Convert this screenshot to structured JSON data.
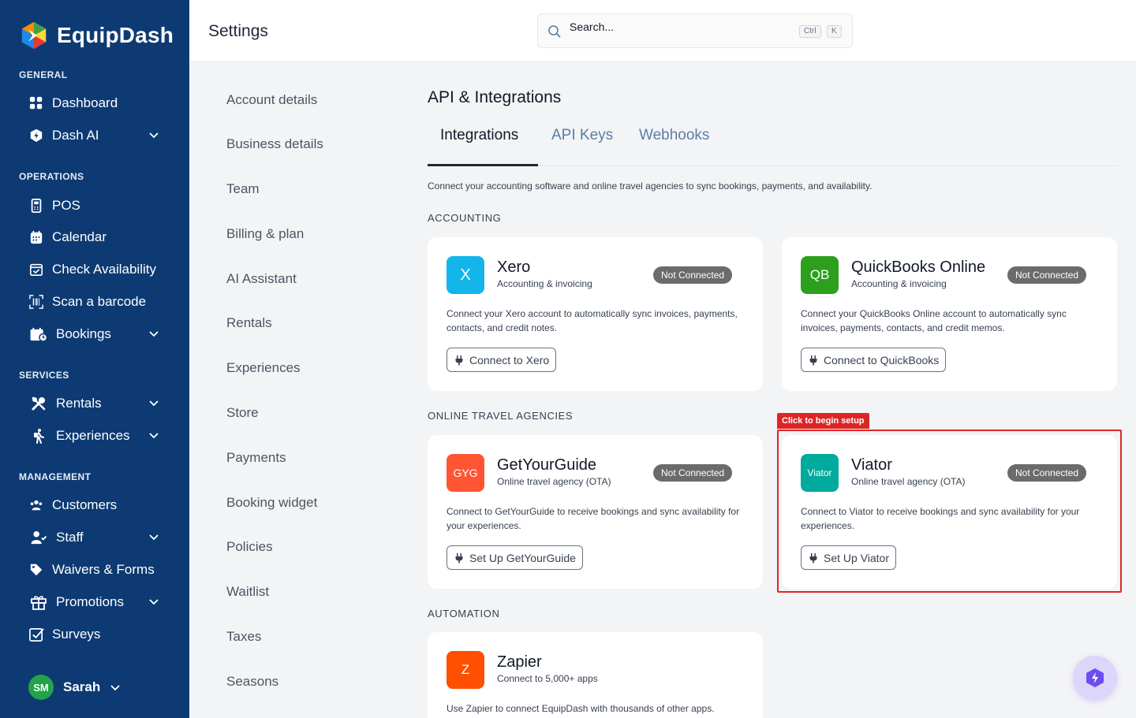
{
  "brand": {
    "name": "EquipDash"
  },
  "sidebar": {
    "sections": {
      "general": "GENERAL",
      "operations": "OPERATIONS",
      "services": "SERVICES",
      "management": "MANAGEMENT"
    },
    "items": {
      "dashboard": "Dashboard",
      "dash_ai": "Dash AI",
      "pos": "POS",
      "calendar": "Calendar",
      "check_availability": "Check Availability",
      "scan_barcode": "Scan a barcode",
      "bookings": "Bookings",
      "rentals": "Rentals",
      "experiences": "Experiences",
      "customers": "Customers",
      "staff": "Staff",
      "waivers": "Waivers & Forms",
      "promotions": "Promotions",
      "surveys": "Surveys"
    },
    "user": {
      "initials": "SM",
      "name": "Sarah"
    }
  },
  "header": {
    "title": "Settings",
    "search_placeholder": "Search...",
    "kbd_ctrl": "Ctrl",
    "kbd_k": "K"
  },
  "settings_nav": {
    "account": "Account details",
    "business": "Business details",
    "team": "Team",
    "billing": "Billing & plan",
    "ai": "AI Assistant",
    "rentals": "Rentals",
    "experiences": "Experiences",
    "store": "Store",
    "payments": "Payments",
    "booking_widget": "Booking widget",
    "policies": "Policies",
    "waitlist": "Waitlist",
    "taxes": "Taxes",
    "seasons": "Seasons"
  },
  "main": {
    "title": "API & Integrations",
    "tabs": {
      "integrations": "Integrations",
      "api_keys": "API Keys",
      "webhooks": "Webhooks"
    },
    "description": "Connect your accounting software and online travel agencies to sync bookings, payments, and availability.",
    "sections": {
      "accounting": "ACCOUNTING",
      "ota": "ONLINE TRAVEL AGENCIES",
      "automation": "AUTOMATION"
    },
    "status_not_connected": "Not Connected",
    "cards": {
      "xero": {
        "logo": "X",
        "name": "Xero",
        "subtitle": "Accounting & invoicing",
        "description": "Connect your Xero account to automatically sync invoices, payments, contacts, and credit notes.",
        "button": "Connect to Xero",
        "color": "#13b5ea"
      },
      "quickbooks": {
        "logo": "QB",
        "name": "QuickBooks Online",
        "subtitle": "Accounting & invoicing",
        "description": "Connect your QuickBooks Online account to automatically sync invoices, payments, contacts, and credit memos.",
        "button": "Connect to QuickBooks",
        "color": "#2ca01c"
      },
      "getyourguide": {
        "logo": "GYG",
        "name": "GetYourGuide",
        "subtitle": "Online travel agency (OTA)",
        "description": "Connect to GetYourGuide to receive bookings and sync availability for your experiences.",
        "button": "Set Up GetYourGuide",
        "color": "#ff5533"
      },
      "viator": {
        "logo": "Viator",
        "name": "Viator",
        "subtitle": "Online travel agency (OTA)",
        "description": "Connect to Viator to receive bookings and sync availability for your experiences.",
        "button": "Set Up Viator",
        "color": "#00aa9c"
      },
      "zapier": {
        "logo": "Z",
        "name": "Zapier",
        "subtitle": "Connect to 5,000+ apps",
        "description": "Use Zapier to connect EquipDash with thousands of other apps.",
        "color": "#ff4f00"
      }
    },
    "highlight_tag": "Click to begin setup"
  }
}
